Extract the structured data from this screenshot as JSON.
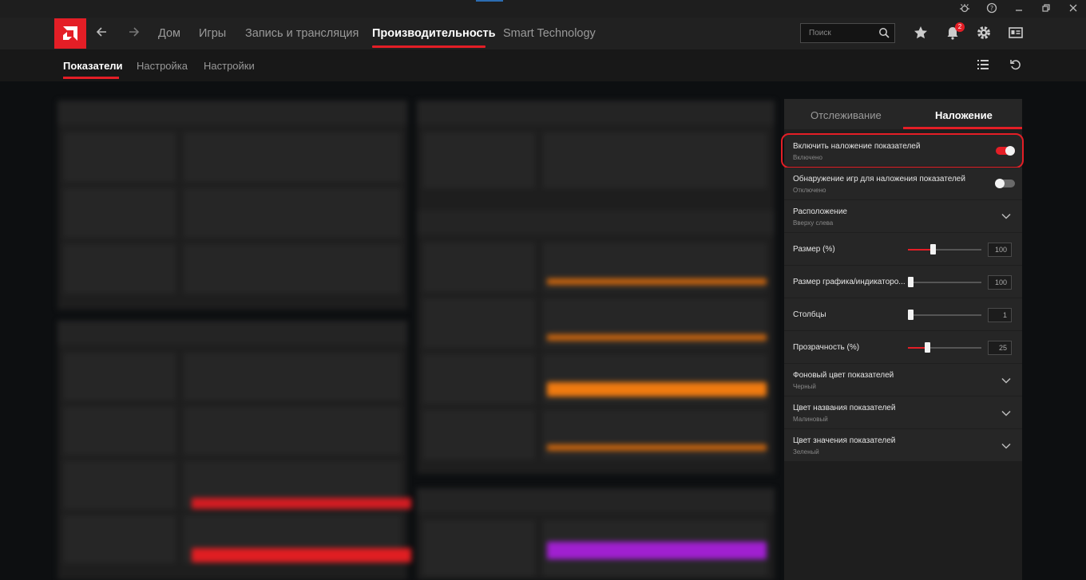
{
  "nav": {
    "items": [
      "Дом",
      "Игры",
      "Запись и трансляция",
      "Производительность",
      "Smart Technology"
    ],
    "active_index": 3,
    "search_placeholder": "Поиск",
    "notification_count": "2"
  },
  "subnav": {
    "items": [
      "Показатели",
      "Настройка",
      "Настройки"
    ],
    "active_index": 0
  },
  "overlay_panel": {
    "tabs": [
      "Отслеживание",
      "Наложение"
    ],
    "active_tab": 1,
    "enable_overlay": {
      "label": "Включить наложение показателей",
      "status": "Включено",
      "on": true
    },
    "game_detection": {
      "label": "Обнаружение игр для наложения показателей",
      "status": "Отключено",
      "on": false
    },
    "position": {
      "label": "Расположение",
      "value": "Вверху слева"
    },
    "size": {
      "label": "Размер (%)",
      "value": "100",
      "fraction": 0.34
    },
    "graph_size": {
      "label": "Размер графика/индикаторо...",
      "value": "100",
      "fraction": 0.0
    },
    "columns": {
      "label": "Столбцы",
      "value": "1",
      "fraction": 0.0
    },
    "transparency": {
      "label": "Прозрачность (%)",
      "value": "25",
      "fraction": 0.25
    },
    "bg_color": {
      "label": "Фоновый цвет показателей",
      "value": "Черный"
    },
    "name_color": {
      "label": "Цвет названия показателей",
      "value": "Малиновый"
    },
    "value_color": {
      "label": "Цвет значения показателей",
      "value": "Зеленый"
    }
  },
  "colors": {
    "accent": "#e41e26",
    "orange": "#f07a10",
    "purple": "#a020d0"
  }
}
